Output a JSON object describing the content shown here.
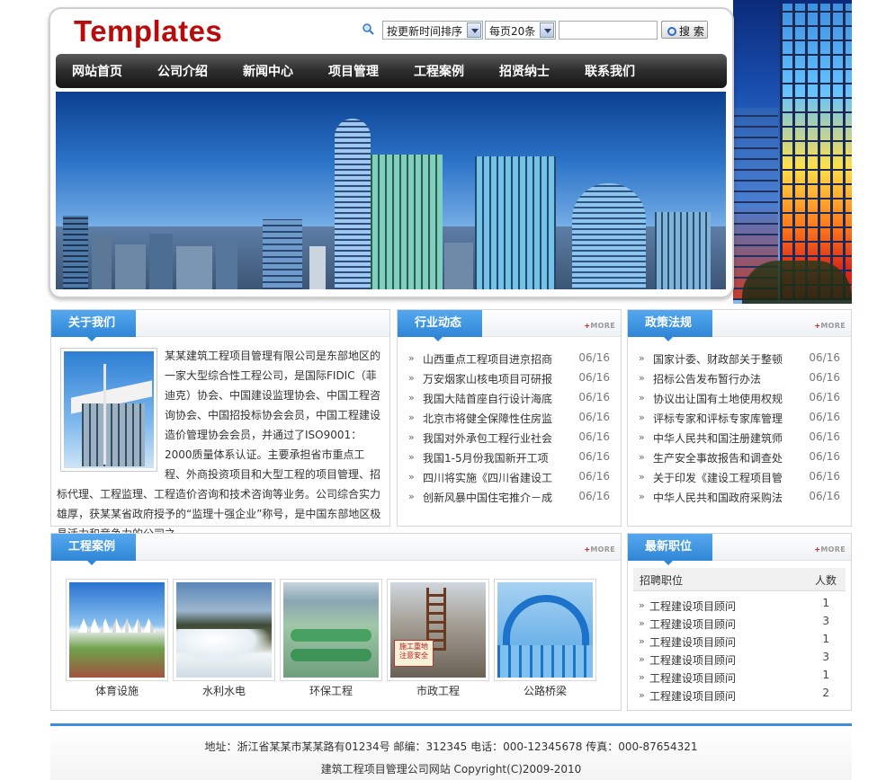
{
  "site": {
    "logo_text": "Templates"
  },
  "search": {
    "sort_selected": "按更新时间排序",
    "page_size_selected": "每页20条",
    "keyword_value": "",
    "button_label": "搜 索"
  },
  "nav": {
    "items": [
      "网站首页",
      "公司介绍",
      "新闻中心",
      "项目管理",
      "工程案例",
      "招贤纳士",
      "联系我们"
    ]
  },
  "about": {
    "title": "关于我们",
    "body": "某某建筑工程项目管理有限公司是东部地区的一家大型综合性工程公司，是国际FIDIC（菲迪克）协会、中国建设监理协会、中国工程咨询协会、中国招投标协会会员，中国工程建设造价管理协会会员，并通过了ISO9001：2000质量体系认证。主要承担省市重点工程、外商投资项目和大型工程的项目管理、招标代理、工程监理、工程造价咨询和技术咨询等业务。公司综合实力雄厚，获某某省政府授予的“监理十强企业”称号，是中国东部地区极具活力和竞争力的公司之一。"
  },
  "industry_news": {
    "title": "行业动态",
    "more_label": "MORE",
    "items": [
      {
        "title": "山西重点工程项目进京招商",
        "date": "06/16"
      },
      {
        "title": "万安烟家山核电项目可研报",
        "date": "06/16"
      },
      {
        "title": "我国大陆首座自行设计海底",
        "date": "06/16"
      },
      {
        "title": "北京市将健全保障性住房监",
        "date": "06/16"
      },
      {
        "title": "我国对外承包工程行业社会",
        "date": "06/16"
      },
      {
        "title": "我国1-5月份我国新开工项",
        "date": "06/16"
      },
      {
        "title": "四川将实施《四川省建设工",
        "date": "06/16"
      },
      {
        "title": "创新风暴中国住宅推介－成",
        "date": "06/16"
      }
    ]
  },
  "policy": {
    "title": "政策法规",
    "more_label": "MORE",
    "items": [
      {
        "title": "国家计委、财政部关于整顿",
        "date": "06/16"
      },
      {
        "title": "招标公告发布暂行办法",
        "date": "06/16"
      },
      {
        "title": "协议出让国有土地使用权规",
        "date": "06/16"
      },
      {
        "title": "评标专家和评标专家库管理",
        "date": "06/16"
      },
      {
        "title": "中华人民共和国注册建筑师",
        "date": "06/16"
      },
      {
        "title": "生产安全事故报告和调查处",
        "date": "06/16"
      },
      {
        "title": "关于印发《建设工程项目管",
        "date": "06/16"
      },
      {
        "title": "中华人民共和国政府采购法",
        "date": "06/16"
      }
    ]
  },
  "cases": {
    "title": "工程案例",
    "more_label": "MORE",
    "items": [
      {
        "caption": "体育设施"
      },
      {
        "caption": "水利水电"
      },
      {
        "caption": "环保工程"
      },
      {
        "caption": "市政工程"
      },
      {
        "caption": "公路桥梁"
      }
    ],
    "sign_text": "施工重地 注意安全"
  },
  "jobs": {
    "title": "最新职位",
    "more_label": "MORE",
    "col_position": "招聘职位",
    "col_count": "人数",
    "rows": [
      {
        "position": "工程建设项目顾问",
        "count": "1"
      },
      {
        "position": "工程建设项目顾问",
        "count": "3"
      },
      {
        "position": "工程建设项目顾问",
        "count": "1"
      },
      {
        "position": "工程建设项目顾问",
        "count": "3"
      },
      {
        "position": "工程建设项目顾问",
        "count": "1"
      },
      {
        "position": "工程建设项目顾问",
        "count": "2"
      }
    ]
  },
  "footer": {
    "line1": "地址：浙江省某某市某某路有01234号 邮编：312345 电话：000-12345678 传真：000-87654321",
    "line2": "建筑工程项目管理公司网站  Copyright(C)2009-2010"
  },
  "colors": {
    "brand_red": "#b80b0b",
    "tab_blue": "#2f86d6",
    "nav_dark": "#222222"
  }
}
